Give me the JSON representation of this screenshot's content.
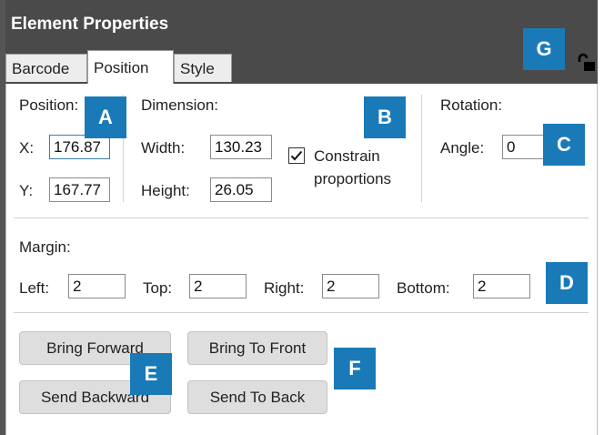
{
  "window": {
    "title": "Element Properties"
  },
  "tabs": [
    {
      "label": "Barcode",
      "active": false
    },
    {
      "label": "Position",
      "active": true
    },
    {
      "label": "Style",
      "active": false
    }
  ],
  "position": {
    "group_label": "Position:",
    "x_label": "X:",
    "x_value": "176.87",
    "y_label": "Y:",
    "y_value": "167.77"
  },
  "dimension": {
    "group_label": "Dimension:",
    "width_label": "Width:",
    "width_value": "130.23",
    "height_label": "Height:",
    "height_value": "26.05",
    "constrain_label_line1": "Constrain",
    "constrain_label_line2": "proportions",
    "constrain_checked": true
  },
  "rotation": {
    "group_label": "Rotation:",
    "angle_label": "Angle:",
    "angle_value": "0"
  },
  "margin": {
    "group_label": "Margin:",
    "left_label": "Left:",
    "left_value": "2",
    "top_label": "Top:",
    "top_value": "2",
    "right_label": "Right:",
    "right_value": "2",
    "bottom_label": "Bottom:",
    "bottom_value": "2"
  },
  "buttons": {
    "bring_forward": "Bring Forward",
    "bring_to_front": "Bring To Front",
    "send_backward": "Send Backward",
    "send_to_back": "Send To Back"
  },
  "callouts": {
    "a": "A",
    "b": "B",
    "c": "C",
    "d": "D",
    "e": "E",
    "f": "F",
    "g": "G"
  },
  "icons": {
    "lock": "unlock-icon",
    "check": "check-icon"
  },
  "colors": {
    "titlebar": "#4a4a4a",
    "callout": "#1a7ab8",
    "input_focus": "#3c7fb1"
  }
}
